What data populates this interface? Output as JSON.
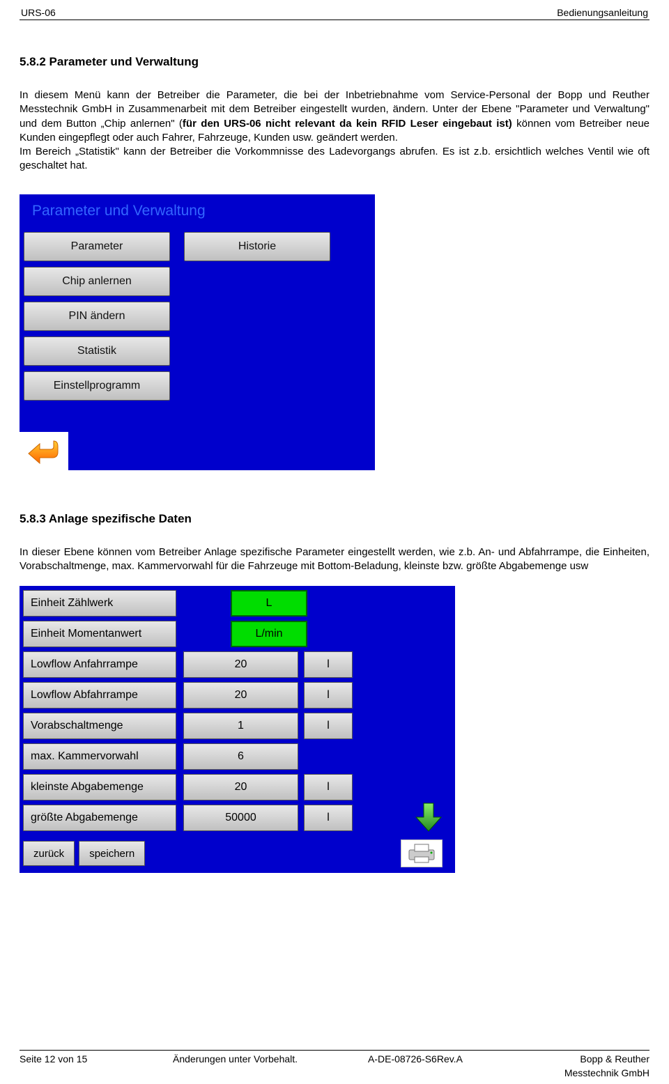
{
  "header": {
    "left": "URS-06",
    "right": "Bedienungsanleitung"
  },
  "section1": {
    "heading": "5.8.2 Parameter und Verwaltung",
    "para_part1": "In diesem Menü kann der Betreiber die Parameter, die bei der Inbetriebnahme vom Service-Personal der Bopp und Reuther Messtechnik GmbH in Zusammenarbeit mit dem Betreiber eingestellt wurden, ändern. Unter der Ebene \"Parameter und Verwaltung\" und dem Button „Chip anlernen\" (",
    "para_bold1": "für den URS-06 nicht relevant da kein RFID Leser eingebaut ist)",
    "para_part2": " können vom Betreiber neue Kunden eingepflegt oder auch Fahrer, Fahrzeuge, Kunden usw. geändert werden.",
    "para_part3": "Im Bereich „Statistik\" kann der Betreiber die Vorkommnisse des Ladevorgangs abrufen.  Es ist z.b. ersichtlich welches Ventil wie oft geschaltet hat."
  },
  "screen1": {
    "title": "Parameter und Verwaltung",
    "buttons": {
      "parameter": "Parameter",
      "historie": "Historie",
      "chip": "Chip anlernen",
      "pin": "PIN ändern",
      "statistik": "Statistik",
      "einstell": "Einstellprogramm"
    }
  },
  "section2": {
    "heading": "5.8.3 Anlage spezifische Daten",
    "para": "In dieser Ebene können vom Betreiber Anlage spezifische Parameter eingestellt werden, wie z.b. An- und Abfahrrampe, die Einheiten, Vorabschaltmenge, max. Kammervorwahl für die Fahrzeuge mit Bottom-Beladung, kleinste bzw. größte Abgabemenge usw"
  },
  "screen2": {
    "rows": [
      {
        "label": "Einheit Zählwerk",
        "value": "L",
        "unit": "",
        "green": true
      },
      {
        "label": "Einheit Momentanwert",
        "value": "L/min",
        "unit": "",
        "green": true
      },
      {
        "label": "Lowflow Anfahrrampe",
        "value": "20",
        "unit": "l",
        "green": false
      },
      {
        "label": "Lowflow Abfahrrampe",
        "value": "20",
        "unit": "l",
        "green": false
      },
      {
        "label": "Vorabschaltmenge",
        "value": "1",
        "unit": "l",
        "green": false
      },
      {
        "label": "max. Kammervorwahl",
        "value": "6",
        "unit": "",
        "green": false
      },
      {
        "label": "kleinste Abgabemenge",
        "value": "20",
        "unit": "l",
        "green": false
      },
      {
        "label": "größte Abgabemenge",
        "value": "50000",
        "unit": "l",
        "green": false
      }
    ],
    "back": "zurück",
    "save": "speichern"
  },
  "footer": {
    "page": "Seite 12 von 15",
    "change": "Änderungen unter Vorbehalt.",
    "rev": "A-DE-08726-S6Rev.A",
    "company1": "Bopp & Reuther",
    "company2": "Messtechnik GmbH"
  }
}
